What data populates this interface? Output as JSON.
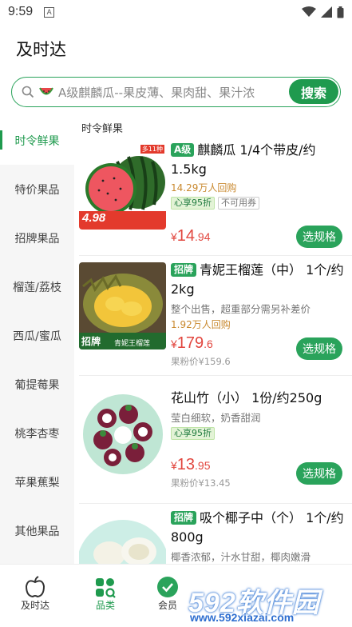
{
  "status": {
    "time": "9:59",
    "indicator": "A"
  },
  "app": {
    "title": "及时达"
  },
  "search": {
    "placeholder": "A级麒麟瓜--果皮薄、果肉甜、果汁浓",
    "button": "搜索"
  },
  "sidebar": {
    "items": [
      {
        "label": "时令鲜果",
        "active": true
      },
      {
        "label": "特价果品"
      },
      {
        "label": "招牌果品"
      },
      {
        "label": "榴莲/荔枝"
      },
      {
        "label": "西瓜/蜜瓜"
      },
      {
        "label": "葡提莓果"
      },
      {
        "label": "桃李杏枣"
      },
      {
        "label": "苹果蕉梨"
      },
      {
        "label": "其他果品"
      }
    ]
  },
  "section": {
    "title": "时令鲜果"
  },
  "products": [
    {
      "tag": "A级",
      "name": "麒麟瓜 1/4个带皮/约1.5kg",
      "sold": "14.29万人回购",
      "badge1": "心享95折",
      "badge2": "不可用券",
      "price_yen": "¥",
      "price_int": "14",
      "price_dec": ".94",
      "button": "选规格",
      "img": {
        "sticker": "4.98",
        "corner": "多11种"
      }
    },
    {
      "tag": "招牌",
      "name": "青妮王榴莲（中） 1个/约2kg",
      "desc": "整个出售，超重部分需另补差价",
      "sold": "1.92万人回购",
      "price_yen": "¥",
      "price_int": "179",
      "price_dec": ".6",
      "market": "果粉价¥159.6",
      "button": "选规格",
      "img": {
        "badge": "招牌",
        "caption": "青妮王榴莲"
      }
    },
    {
      "name": "花山竹（小） 1份/约250g",
      "desc": "莹白细软，奶香甜润",
      "badge1": "心享95折",
      "price_yen": "¥",
      "price_int": "13",
      "price_dec": ".95",
      "market": "果粉价¥13.45",
      "button": "选规格"
    },
    {
      "tag": "招牌",
      "name": "吸个椰子中（个） 1个/约800g",
      "desc": "椰香浓郁，汁水甘甜，椰肉嫩滑"
    }
  ],
  "tabbar": {
    "items": [
      {
        "label": "及时达"
      },
      {
        "label": "品类"
      },
      {
        "label": "会员"
      }
    ]
  },
  "watermark": {
    "logo": "592软件园",
    "url": "www.592xiazai.com"
  },
  "colors": {
    "brand": "#1f9a4e",
    "price": "#e2473f",
    "sold": "#c9892f"
  }
}
